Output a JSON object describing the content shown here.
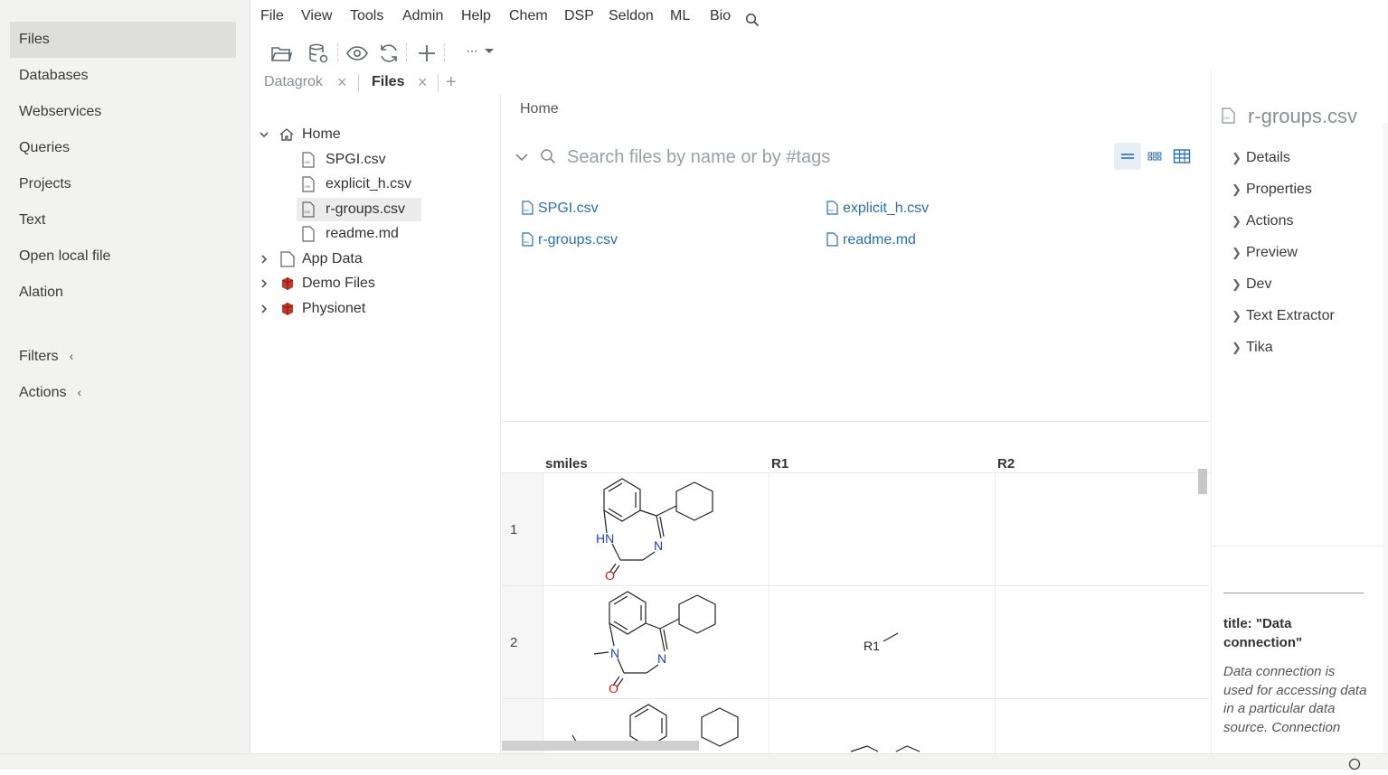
{
  "sidebar": {
    "items": [
      {
        "label": "Files"
      },
      {
        "label": "Databases"
      },
      {
        "label": "Webservices"
      },
      {
        "label": "Queries"
      },
      {
        "label": "Projects"
      },
      {
        "label": "Text"
      },
      {
        "label": "Open local file"
      },
      {
        "label": "Alation"
      }
    ],
    "filters_label": "Filters",
    "actions_label": "Actions",
    "collapse_chevron": "‹"
  },
  "menu": [
    "File",
    "View",
    "Tools",
    "Admin",
    "Help",
    "Chem",
    "DSP",
    "Seldon",
    "ML",
    "Bio"
  ],
  "toolbar": {
    "more_label": "···"
  },
  "tabs": [
    {
      "label": "Datagrok"
    },
    {
      "label": "Files"
    }
  ],
  "tab_close": "×",
  "tab_add": "+",
  "tree": {
    "home": "Home",
    "files": [
      "SPGI.csv",
      "explicit_h.csv",
      "r-groups.csv",
      "readme.md"
    ],
    "roots": [
      "App Data",
      "Demo Files",
      "Physionet"
    ]
  },
  "main": {
    "breadcrumb": "Home",
    "search_placeholder": "Search files by name or by #tags",
    "files": [
      "SPGI.csv",
      "explicit_h.csv",
      "r-groups.csv",
      "readme.md"
    ]
  },
  "grid": {
    "columns": [
      "smiles",
      "R1",
      "R2"
    ],
    "rows": [
      "1",
      "2"
    ],
    "atoms": {
      "hn": "HN",
      "n": "N",
      "o": "O",
      "r1": "R1"
    }
  },
  "right_panel": {
    "title": "r-groups.csv",
    "sections": [
      "Details",
      "Properties",
      "Actions",
      "Preview",
      "Dev",
      "Text Extractor",
      "Tika"
    ],
    "help_title": "title: \"Data connection\"",
    "help_body": "Data connection is used for accessing data in a particular data source. Connection"
  },
  "colors": {
    "link": "#2a6fb7",
    "accent": "#2a6fb7",
    "nitrogen": "#1d3fd1",
    "oxygen": "#d4261c",
    "db_icon": "#c0392b"
  }
}
